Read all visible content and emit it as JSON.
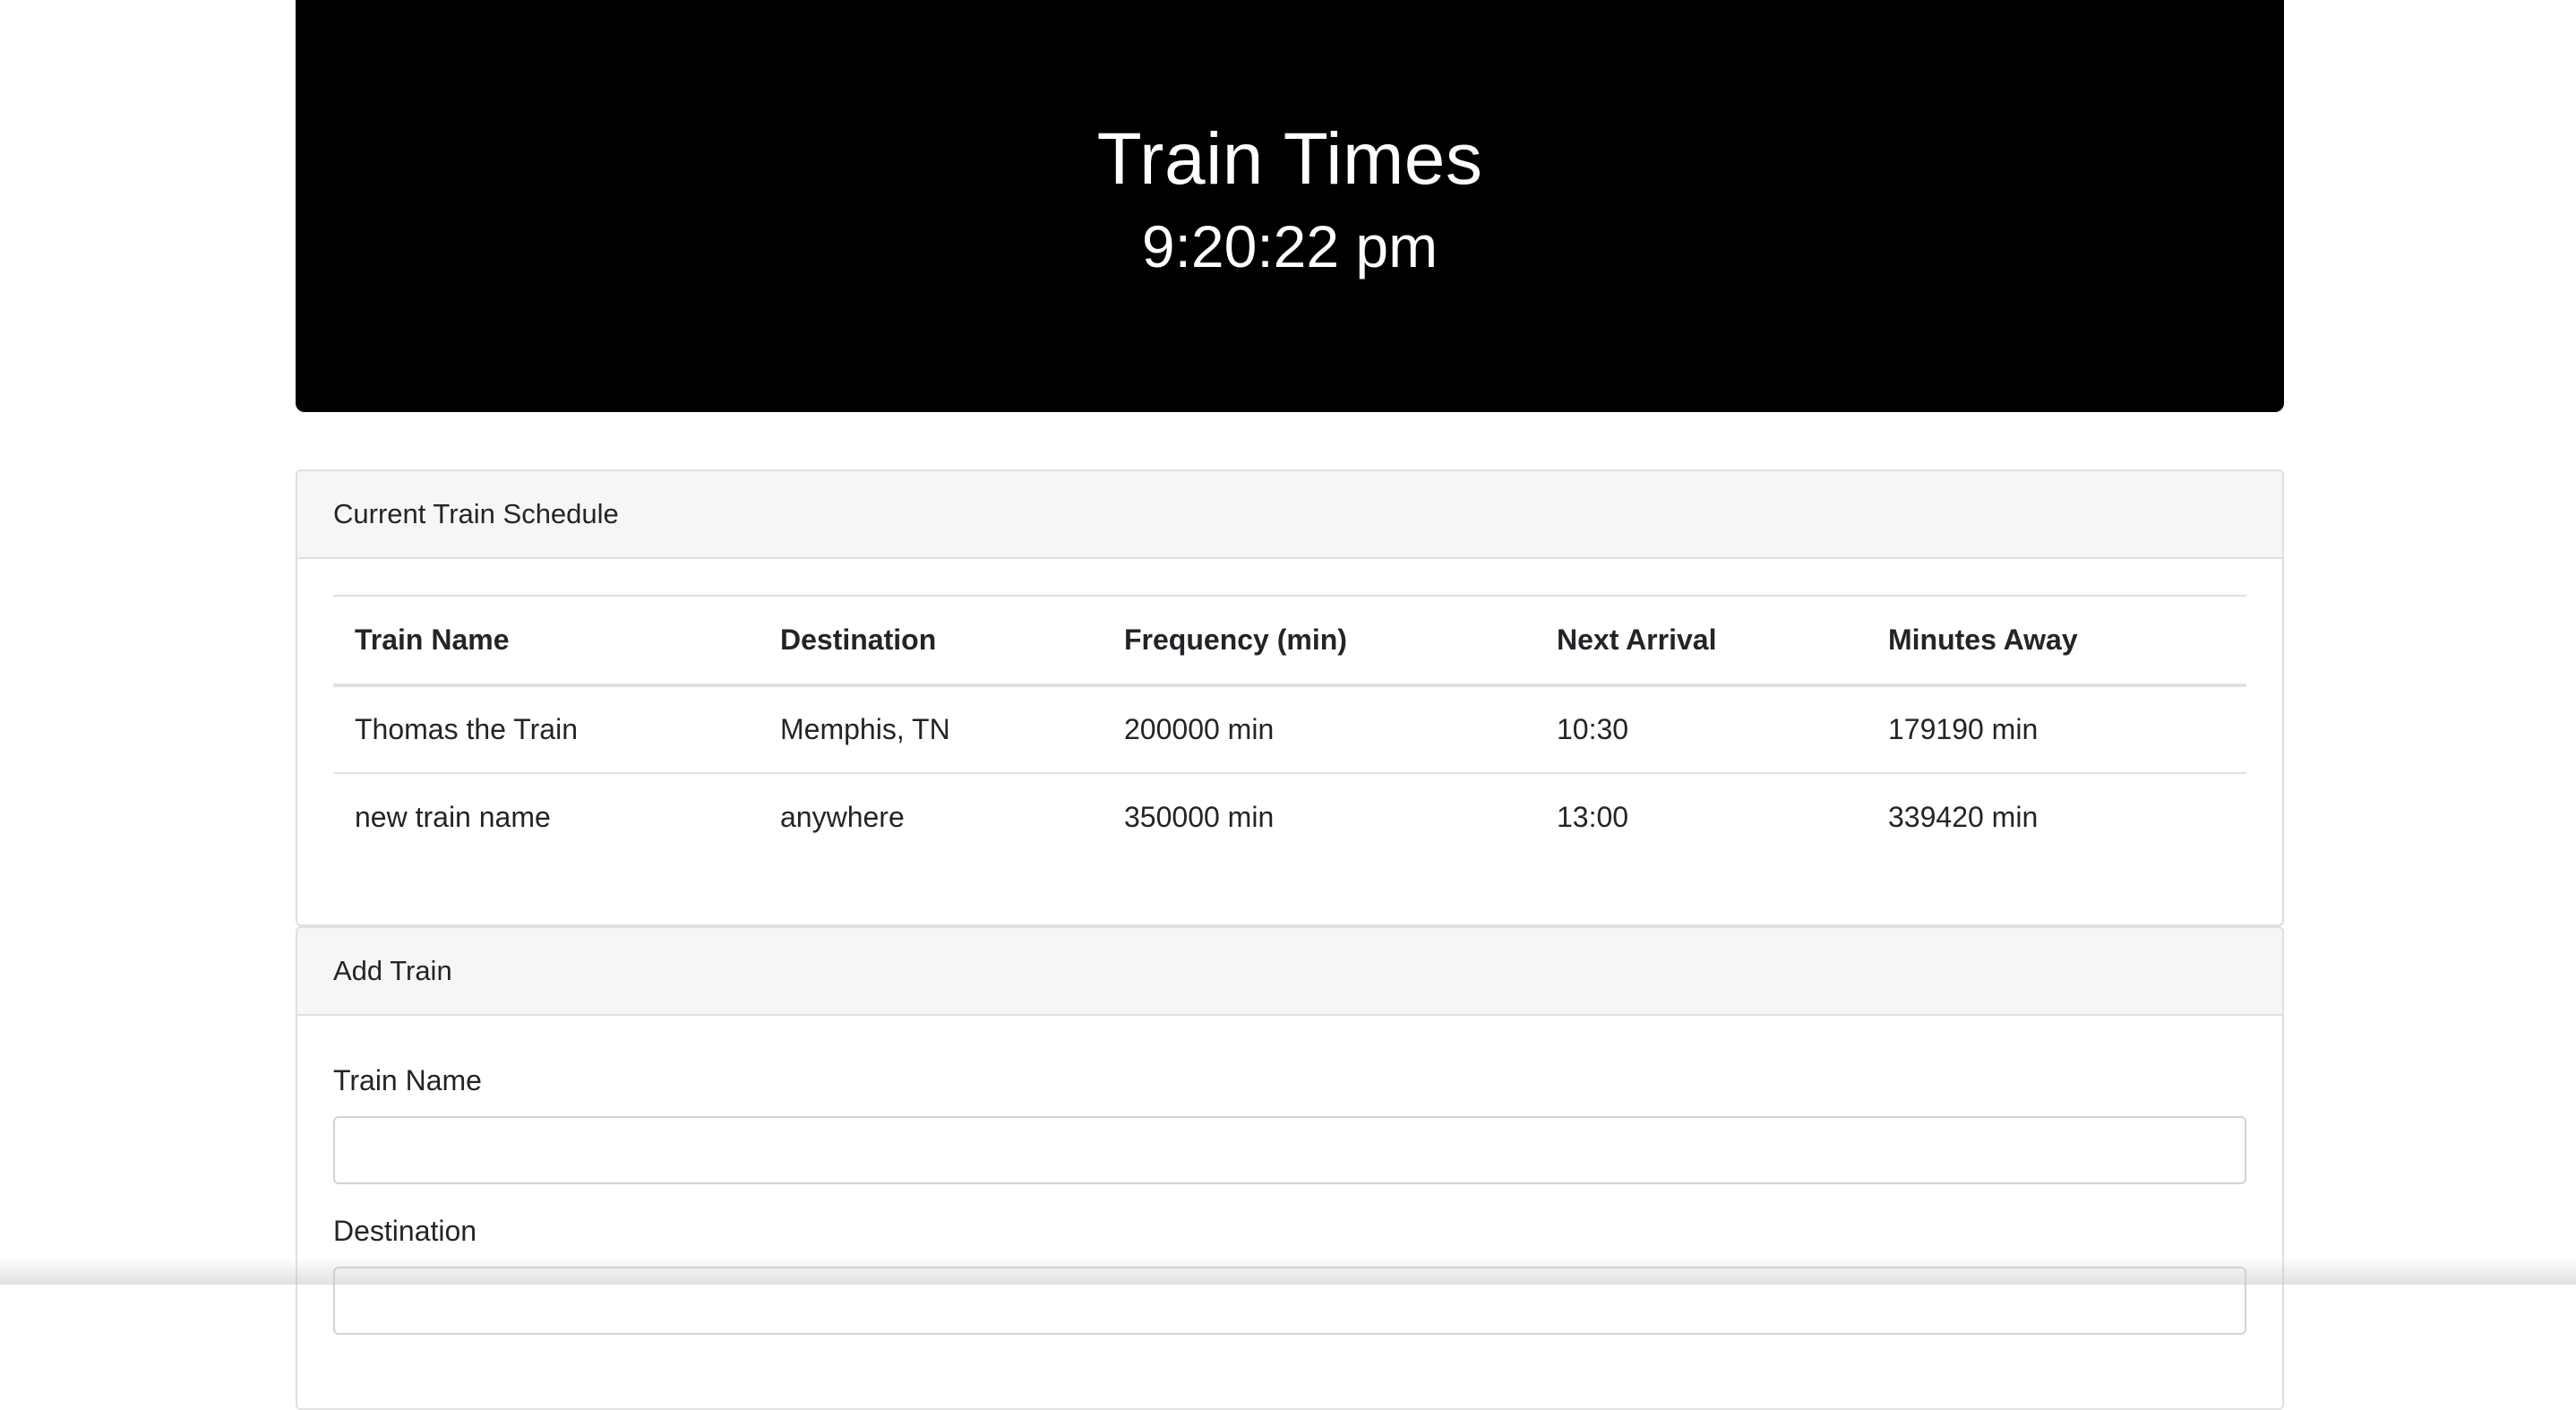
{
  "header": {
    "title": "Train Times",
    "clock": "9:20:22 pm"
  },
  "schedule": {
    "heading": "Current Train Schedule",
    "columns": [
      "Train Name",
      "Destination",
      "Frequency (min)",
      "Next Arrival",
      "Minutes Away"
    ],
    "rows": [
      [
        "Thomas the Train",
        "Memphis, TN",
        "200000 min",
        "10:30",
        "179190 min"
      ],
      [
        "new train name",
        "anywhere",
        "350000 min",
        "13:00",
        "339420 min"
      ]
    ]
  },
  "add_train": {
    "heading": "Add Train",
    "fields": [
      {
        "label": "Train Name",
        "value": ""
      },
      {
        "label": "Destination",
        "value": ""
      }
    ]
  }
}
